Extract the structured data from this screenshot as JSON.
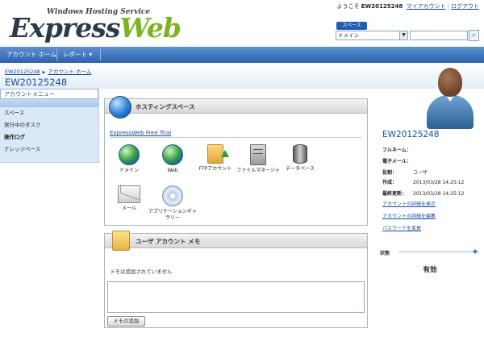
{
  "header": {
    "logo_sub": "Windows Hosting Service",
    "logo_part1": "Express",
    "logo_part2": "Web",
    "welcome": "ようこそ",
    "username": "EW20125248",
    "my_account": "マイアカウント",
    "separator": "|",
    "logout": "ログアウト",
    "space_tag": "スペース",
    "space_select": "ドメイン",
    "search_value": ""
  },
  "nav": {
    "items": [
      {
        "label": "アカウント ホーム"
      },
      {
        "label": "レポート ▾"
      }
    ]
  },
  "breadcrumb": {
    "items": [
      "EW20125248",
      "アカウント ホーム"
    ]
  },
  "page_title": "EW20125248",
  "sidebar": {
    "header": "アカウントメニュー",
    "items": [
      {
        "label": "スペース"
      },
      {
        "label": "実行中のタスク"
      },
      {
        "label": "操作ログ"
      },
      {
        "label": "ナレッジベース"
      }
    ]
  },
  "hosting_panel": {
    "title": "ホスティングスペース",
    "plan_link": "ExpressWeb Free Trial",
    "services": [
      {
        "label": "ドメイン",
        "icon": "globe-icon"
      },
      {
        "label": "Web",
        "icon": "globe-icon"
      },
      {
        "label": "FTPアカウント",
        "icon": "folder-upload-icon"
      },
      {
        "label": "ファイルマネージャ",
        "icon": "file-cabinet-icon"
      },
      {
        "label": "データベース",
        "icon": "database-icon"
      },
      {
        "label": "メール",
        "icon": "mail-icon"
      },
      {
        "label": "アプリケーションギャラリー",
        "icon": "cd-icon"
      }
    ]
  },
  "memo_panel": {
    "title": "ユーザ アカウント メモ",
    "status": "メモは追加されていません",
    "text_value": "",
    "add_button": "メモの追加"
  },
  "account": {
    "title": "EW20125248",
    "rows": [
      {
        "label": "フルネーム：",
        "value": ""
      },
      {
        "label": "電子メール：",
        "value": ""
      },
      {
        "label": "役割：",
        "value": "ユーザ"
      },
      {
        "label": "作成：",
        "value": "2013/03/28 14:25:12"
      },
      {
        "label": "最終更新：",
        "value": "2013/03/28 14:25:12"
      }
    ],
    "links": [
      "アカウントの詳細を表示",
      "アカウントの詳細を編集",
      "パスワードを変更"
    ],
    "status_label": "状態",
    "status_value": "有効"
  }
}
